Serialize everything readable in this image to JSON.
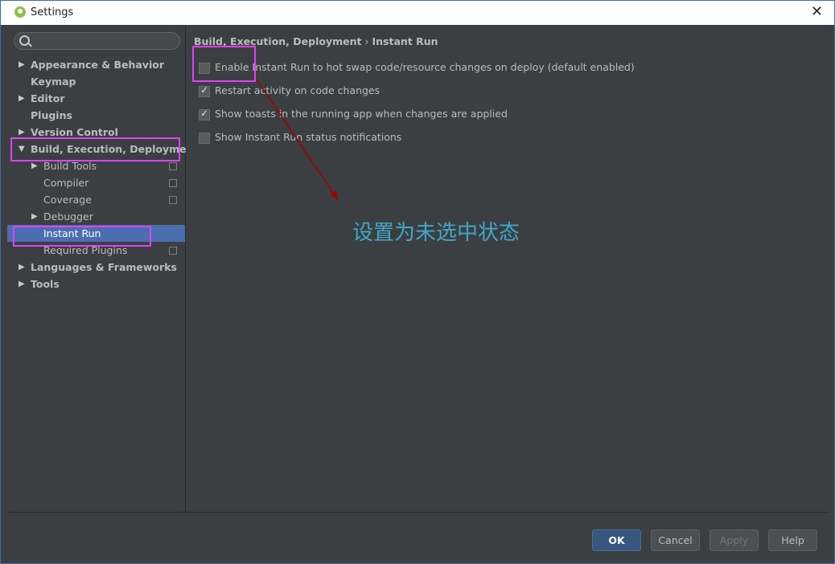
{
  "window": {
    "title": "Settings",
    "close_glyph": "✕"
  },
  "search": {
    "placeholder": ""
  },
  "tree": [
    {
      "label": "Appearance & Behavior",
      "arrow": "▶",
      "bold": true
    },
    {
      "label": "Keymap",
      "bold": true
    },
    {
      "label": "Editor",
      "arrow": "▶",
      "bold": true
    },
    {
      "label": "Plugins",
      "bold": true
    },
    {
      "label": "Version Control",
      "arrow": "▶",
      "bold": true
    },
    {
      "label": "Build, Execution, Deployment",
      "arrow": "▼",
      "bold": true
    },
    {
      "label": "Build Tools",
      "arrow": "▶",
      "child": true
    },
    {
      "label": "Compiler",
      "child": true
    },
    {
      "label": "Coverage",
      "child": true
    },
    {
      "label": "Debugger",
      "arrow": "▶",
      "child": true
    },
    {
      "label": "Instant Run",
      "child": true,
      "selected": true
    },
    {
      "label": "Required Plugins",
      "child": true
    },
    {
      "label": "Languages & Frameworks",
      "arrow": "▶",
      "bold": true
    },
    {
      "label": "Tools",
      "arrow": "▶",
      "bold": true
    }
  ],
  "breadcrumb": {
    "parent": "Build, Execution, Deployment",
    "separator": "›",
    "current": "Instant Run"
  },
  "options": [
    {
      "label": "Enable Instant Run to hot swap code/resource changes on deploy (default enabled)",
      "checked": false
    },
    {
      "label": "Restart activity on code changes",
      "checked": true
    },
    {
      "label": "Show toasts in the running app when changes are applied",
      "checked": true
    },
    {
      "label": "Show Instant Run status notifications",
      "checked": false
    }
  ],
  "annotation": {
    "text": "设置为未选中状态",
    "color": "#3fa7c8"
  },
  "highlight_color": "#e040fb",
  "buttons": {
    "ok": "OK",
    "cancel": "Cancel",
    "apply": "Apply",
    "help": "Help"
  }
}
